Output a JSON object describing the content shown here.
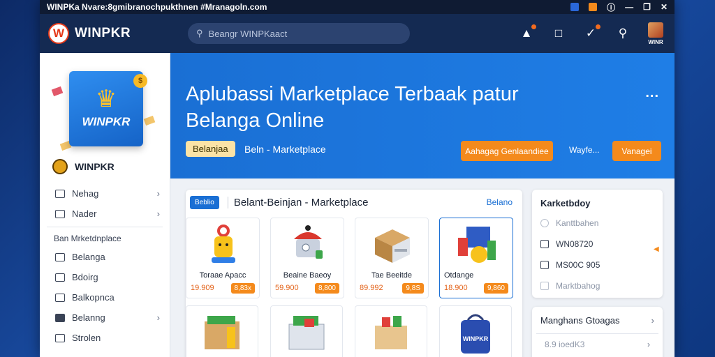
{
  "titlebar": {
    "title": "WINPKa Nvare:8gmibranochpukthnen #Mranagoln.com"
  },
  "header": {
    "brand": "WINPKR",
    "search_placeholder": "Beangr WINPKaact"
  },
  "user": {
    "name": "WINR"
  },
  "sidebar": {
    "logo_text": "WINPKR",
    "brand_label": "WINPKR",
    "items_top": [
      {
        "label": "Nehag"
      },
      {
        "label": "Nader"
      }
    ],
    "section": "Ban Mrketdnplace",
    "items": [
      {
        "label": "Belanga"
      },
      {
        "label": "Bdoirg"
      },
      {
        "label": "Balkopnca"
      },
      {
        "label": "Belanng"
      },
      {
        "label": "Strolen"
      }
    ]
  },
  "hero": {
    "title_line1": "Aplubassi Marketplace Terbaak patur",
    "title_line2": "Belanga Online",
    "pill": "Belanjaa",
    "subtitle": "Beln - Marketplace",
    "btn_primary": "Aahagag Genlaandiee",
    "link": "Wayfe...",
    "btn_secondary": "Vanagei",
    "more": "..."
  },
  "panel": {
    "tag": "Beblio",
    "title": "Belant-Beinjan -  Marketplace",
    "link": "Belano",
    "products": [
      {
        "name": "Toraae Apacc",
        "price": "19.909",
        "tag": "8,83x"
      },
      {
        "name": "Beaine Baeoy",
        "price": "59.900",
        "tag": "8,800"
      },
      {
        "name": "Tae Beeitde",
        "price": "89.992",
        "tag": "9,8S"
      },
      {
        "name": "Otdange",
        "price": "18.900",
        "tag": "9,860"
      }
    ],
    "bottom_product_label": "WINPKR"
  },
  "right": {
    "card1": {
      "title": "Karketbdoy",
      "rows": [
        {
          "label": "Kanttbahen"
        },
        {
          "label": "WN08720"
        },
        {
          "label": "MS00C 905"
        },
        {
          "label": "Marktbahog"
        }
      ]
    },
    "card2": {
      "title": "Manghans Gtoagas",
      "rows": [
        {
          "label": "8.9 ioedK3"
        }
      ]
    }
  }
}
